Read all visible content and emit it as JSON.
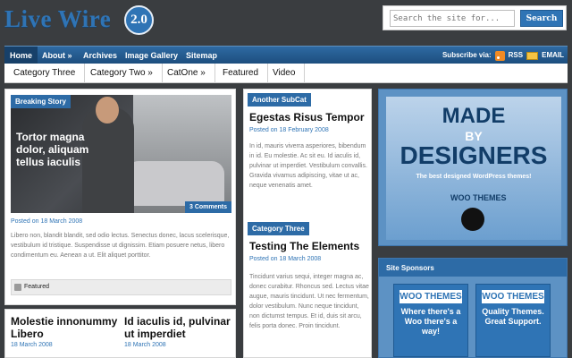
{
  "header": {
    "logo_text": "Live Wire",
    "logo_version": "2.0",
    "search_placeholder": "Search the site for...",
    "search_button": "Search"
  },
  "main_nav": {
    "items": [
      "Home",
      "About »",
      "Archives",
      "Image Gallery",
      "Sitemap"
    ],
    "subscribe_label": "Subscribe via:",
    "rss_label": "RSS",
    "email_label": "EMAIL"
  },
  "category_nav": {
    "items": [
      "Category Three",
      "Category Two »",
      "CatOne »",
      "Featured",
      "Video"
    ]
  },
  "breaking": {
    "label": "Breaking Story",
    "title": "Tortor magna dolor, aliquam tellus iaculis",
    "comments": "3 Comments",
    "meta": "Posted on 18 March 2008",
    "excerpt": "Libero non, blandit blandit, sed odio lectus. Senectus donec, lacus scelerisque, vestibulum id tristique. Suspendisse ut dignissim. Etiam posuere netus, libero condimentum eu. Aenean a ut. Elit aliquet porttitor.",
    "tag": "Featured"
  },
  "bottom_left": [
    {
      "title": "Molestie innonummy Libero",
      "meta": "18 March 2008"
    },
    {
      "title": "Id iaculis id, pulvinar ut imperdiet",
      "meta": "18 March 2008"
    }
  ],
  "subcat": {
    "label": "Another SubCat",
    "title": "Egestas Risus Tempor",
    "meta": "Posted on 18 February 2008",
    "excerpt": "In id, mauris viverra asperiores, bibendum in id. Eu molestie. Ac sit eu. Id iaculis id, pulvinar ut imperdiet. Vestibulum convallis. Gravida vivamus adipiscing, vitae ut ac, neque venenatis amet."
  },
  "cat3": {
    "label": "Category Three",
    "title": "Testing The Elements",
    "meta": "Posted on 18 March 2008",
    "excerpt": "Tincidunt varius sequi, integer magna ac, donec curabitur. Rhoncus sed. Lectus vitae augue, mauris tincidunt. Ut nec fermentum, dolor vestibulum. Nunc neque tincidunt, non dictumst tempus. Et id, duis sit arcu, felis porta donec. Proin tincidunt."
  },
  "ad": {
    "made": "MADE",
    "by": "BY",
    "designers": "DESIGNERS",
    "tagline": "The best designed WordPress themes!",
    "brand": "WOO THEMES"
  },
  "sponsors": {
    "title": "Site Sponsors",
    "ads": [
      {
        "logo": "WOO THEMES",
        "text": "Where there's a Woo there's a way!"
      },
      {
        "logo": "WOO THEMES",
        "text": "Quality Themes. Great Support."
      }
    ]
  }
}
